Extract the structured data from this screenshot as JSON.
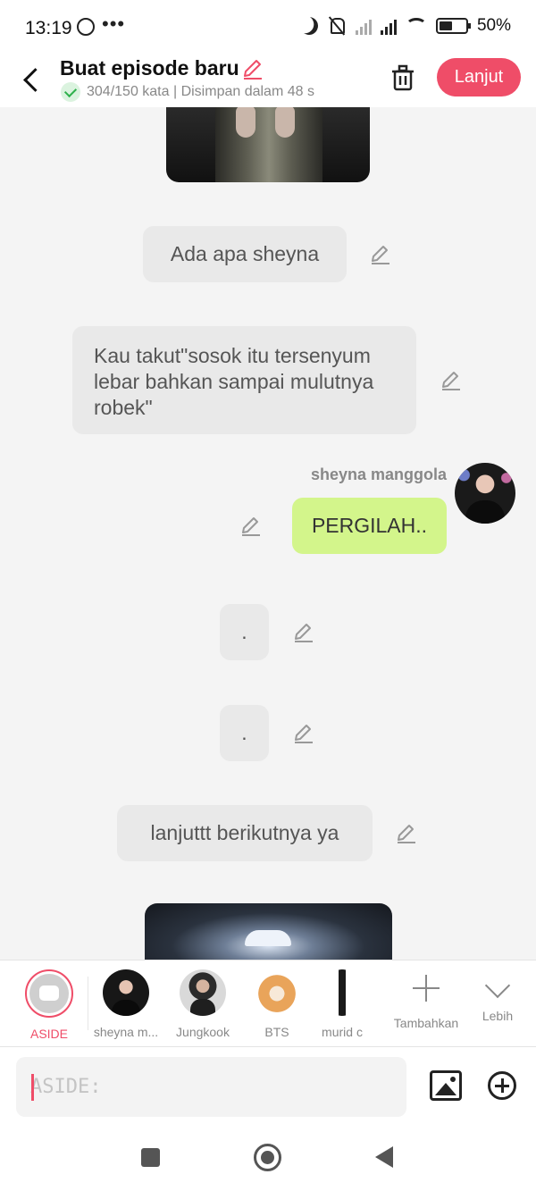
{
  "status_bar": {
    "time": "13:19",
    "overflow": "•••",
    "battery_percent": "50%"
  },
  "header": {
    "title": "Buat episode baru",
    "subtitle": "304/150 kata | Disimpan dalam 48 s",
    "next_button": "Lanjut"
  },
  "messages": [
    {
      "type": "narration",
      "text": "Ada apa sheyna"
    },
    {
      "type": "narration",
      "text": "Kau takut\"sosok itu tersenyum lebar bahkan sampai mulutnya robek\""
    },
    {
      "type": "character",
      "sender": "sheyna manggola",
      "text": "PERGILAH.."
    },
    {
      "type": "narration",
      "text": "."
    },
    {
      "type": "narration",
      "text": "."
    },
    {
      "type": "narration",
      "text": "lanjuttt berikutnya ya"
    }
  ],
  "characters": [
    {
      "label": "ASIDE",
      "active": true
    },
    {
      "label": "sheyna m..."
    },
    {
      "label": "Jungkook"
    },
    {
      "label": "BTS"
    },
    {
      "label": "murid c"
    }
  ],
  "actions": {
    "add_label": "Tambahkan",
    "more_label": "Lebih"
  },
  "input": {
    "placeholder": "ASIDE:"
  },
  "colors": {
    "accent": "#ef4d68",
    "bubble_green": "#d3f58b",
    "bubble_gray": "#e9e9e9"
  },
  "icons": [
    "back-icon",
    "pencil-icon",
    "check-icon",
    "trash-icon",
    "image-icon",
    "add-circle-icon",
    "plus-icon",
    "chevron-down-icon"
  ]
}
